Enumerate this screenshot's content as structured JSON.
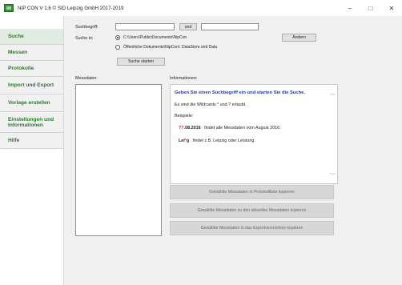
{
  "window": {
    "title": "NIP CON V 1.6  © SID Leipzig GmbH 2017-2019",
    "minimize_glyph": "–",
    "maximize_glyph": "□",
    "close_glyph": "✕"
  },
  "sidebar": {
    "items": [
      {
        "label": "Suche"
      },
      {
        "label": "Messen"
      },
      {
        "label": "Protokolle"
      },
      {
        "label": "Import und Export"
      },
      {
        "label": "Vorlage erstellen"
      },
      {
        "label": "Einstellungen und Informationen"
      },
      {
        "label": "Hilfe"
      }
    ]
  },
  "search": {
    "term_label": "Suchbegriff:",
    "term_value": "",
    "and_button": "und",
    "term2_value": "",
    "scope_label": "Suche in:",
    "option1": "C:\\Users\\Public\\Documents\\NipCon",
    "option2": "Öffentliche Dokumente\\NipCon\\: DataStore und Data",
    "change_button": "Ändern",
    "start_button": "Suche starten"
  },
  "results": {
    "messdaten_label": "Messdaten:",
    "info_label": "Informationen:",
    "info_heading": "Geben Sie einen Suchbegriff ein und starten Sie die Suche.",
    "info_line1": "Es sind die Wildcards * und ? erlaubt.",
    "info_line2": "Beispiele:",
    "example1_red": "??",
    "example1_key": ".08.2016",
    "example1_text": "findet alle Messdaten vom August 2016.",
    "example2_pre": "Lei",
    "example2_red": "*",
    "example2_post": "g",
    "example2_text": "findet z.B. Leipzig oder Leistung."
  },
  "actions": {
    "copy_protocol": "Gewählte Messdaten in Protokollliste kopieren",
    "copy_current": "Gewählte Messdaten zu den aktuellen Messdaten kopieren",
    "copy_export": "Gewählte Messdaten in das Exportverzeichnis kopieren"
  },
  "colors": {
    "sidebar_text": "#2c7a2c",
    "info_heading": "#1f3f8f",
    "wildcard_red": "#d21f1f"
  }
}
